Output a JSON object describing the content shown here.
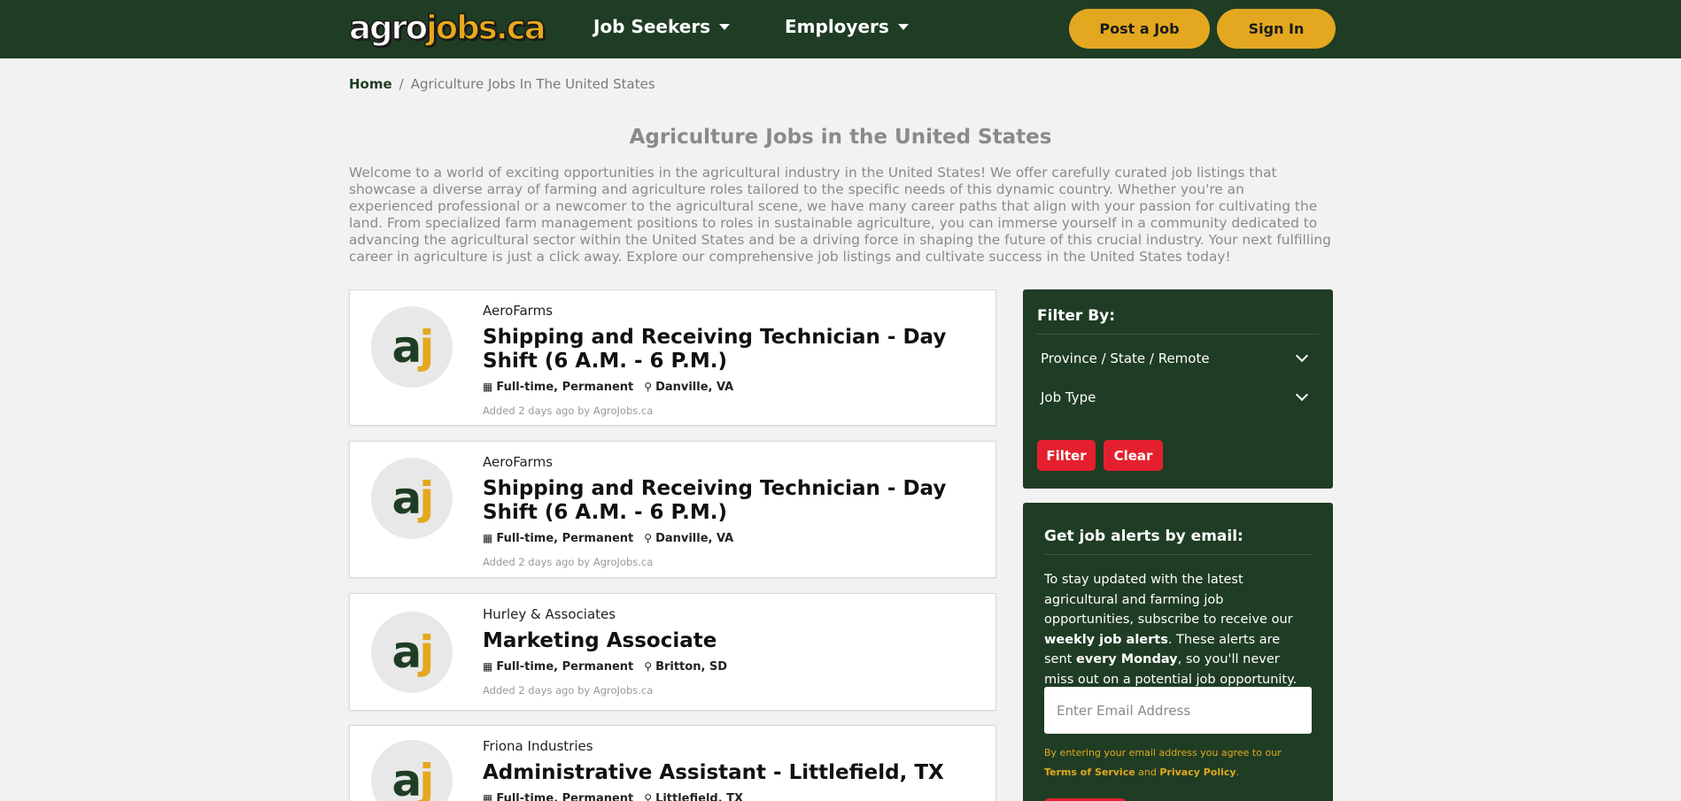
{
  "header": {
    "logo_agro": "agro",
    "logo_jobs": "jobs.ca",
    "nav": [
      {
        "label": "Job Seekers"
      },
      {
        "label": "Employers"
      }
    ],
    "post_job": "Post a Job",
    "sign_in": "Sign In"
  },
  "breadcrumb": {
    "home": "Home",
    "separator": "/",
    "current": "Agriculture Jobs In The United States"
  },
  "page": {
    "title": "Agriculture Jobs in the United States",
    "intro": "Welcome to a world of exciting opportunities in the agricultural industry in the United States! We offer carefully curated job listings that showcase a diverse array of farming and agriculture roles tailored to the specific needs of this dynamic country. Whether you're an experienced professional or a newcomer to the agricultural scene, we have many career paths that align with your passion for cultivating the land. From specialized farm management positions to roles in sustainable agriculture, you can immerse yourself in a community dedicated to advancing the agricultural sector within the United States and be a driving force in shaping the future of this crucial industry. Your next fulfilling career in agriculture is just a click away. Explore our comprehensive job listings and cultivate success in the United States today!"
  },
  "jobs": [
    {
      "logo_a": "a",
      "logo_j": "j",
      "company": "AeroFarms",
      "title": "Shipping and Receiving Technician - Day Shift (6 A.M. - 6 P.M.)",
      "type": "Full-time, Permanent",
      "location": "Danville, VA",
      "added": "Added 2 days ago by AgroJobs.ca"
    },
    {
      "logo_a": "a",
      "logo_j": "j",
      "company": "AeroFarms",
      "title": "Shipping and Receiving Technician - Day Shift (6 A.M. - 6 P.M.)",
      "type": "Full-time, Permanent",
      "location": "Danville, VA",
      "added": "Added 2 days ago by AgroJobs.ca"
    },
    {
      "logo_a": "a",
      "logo_j": "j",
      "company": "Hurley & Associates",
      "title": "Marketing Associate",
      "type": "Full-time, Permanent",
      "location": "Britton, SD",
      "added": "Added 2 days ago by AgroJobs.ca"
    },
    {
      "logo_a": "a",
      "logo_j": "j",
      "company": "Friona Industries",
      "title": "Administrative Assistant - Littlefield, TX",
      "type": "Full-time, Permanent",
      "location": "Littlefield, TX",
      "added": ""
    }
  ],
  "filter": {
    "heading": "Filter By:",
    "province_label": "Province / State / Remote",
    "job_type_label": "Job Type",
    "filter_button": "Filter",
    "clear_button": "Clear"
  },
  "alerts": {
    "heading": "Get job alerts by email:",
    "text_1": "To stay updated with the latest agricultural and farming job opportunities, subscribe to receive our ",
    "text_bold_1": "weekly job alerts",
    "text_2": ". These alerts are sent ",
    "text_bold_2": "every Monday",
    "text_3": ", so you'll never miss out on a potential job opportunity.",
    "email_placeholder": "Enter Email Address",
    "tos_1": "By entering your email address you agree to our ",
    "tos_terms": "Terms of Service",
    "tos_and": " and ",
    "tos_privacy": "Privacy Policy",
    "tos_end": "."
  },
  "colors": {
    "brand_green": "#1f3d24",
    "brand_gold": "#e3a81f",
    "action_red": "#e5202e"
  },
  "icons": {
    "job_type": "calendar-icon",
    "location": "map-marker-icon",
    "dropdown": "chevron-down-icon"
  }
}
